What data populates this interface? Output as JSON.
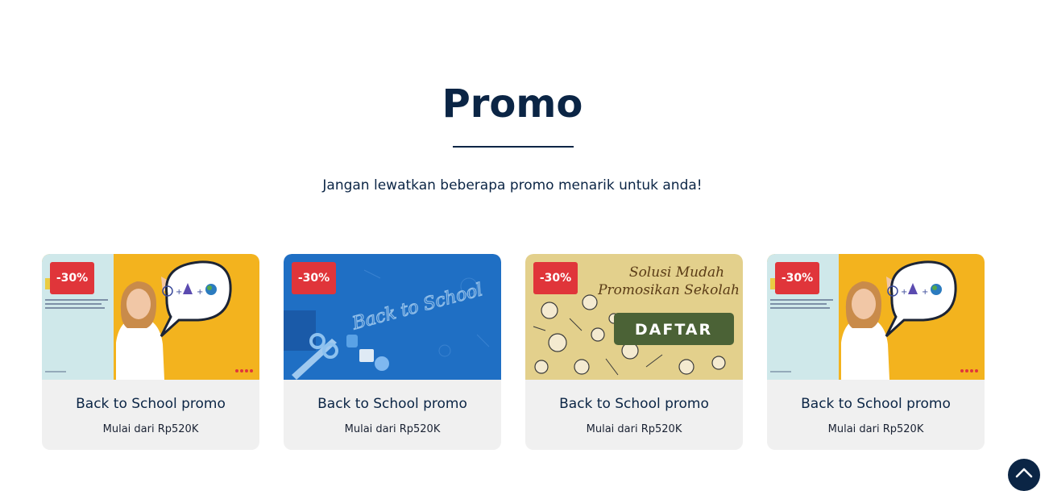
{
  "section": {
    "title": "Promo",
    "subtitle": "Jangan lewatkan beberapa promo menarik untuk anda!"
  },
  "colors": {
    "navy": "#0b2545",
    "badge_red": "#e0353a",
    "card_bg": "#f0f0f0"
  },
  "promos": [
    {
      "badge": "-30%",
      "title": "Back to School promo",
      "price": "Mulai dari Rp520K",
      "image": "girl-speech-bubble-yellow"
    },
    {
      "badge": "-30%",
      "title": "Back to School promo",
      "price": "Mulai dari Rp520K",
      "image": "back-to-school-blue-desk",
      "image_text": "Back to School"
    },
    {
      "badge": "-30%",
      "title": "Back to School promo",
      "price": "Mulai dari Rp520K",
      "image": "doodle-sketch-banner",
      "image_heading_line1": "Solusi Mudah",
      "image_heading_line2": "Promosikan Sekolah",
      "image_button": "DAFTAR"
    },
    {
      "badge": "-30%",
      "title": "Back to School promo",
      "price": "Mulai dari Rp520K",
      "image": "girl-speech-bubble-yellow"
    }
  ],
  "scroll_top": {
    "icon": "chevron-up-icon"
  }
}
